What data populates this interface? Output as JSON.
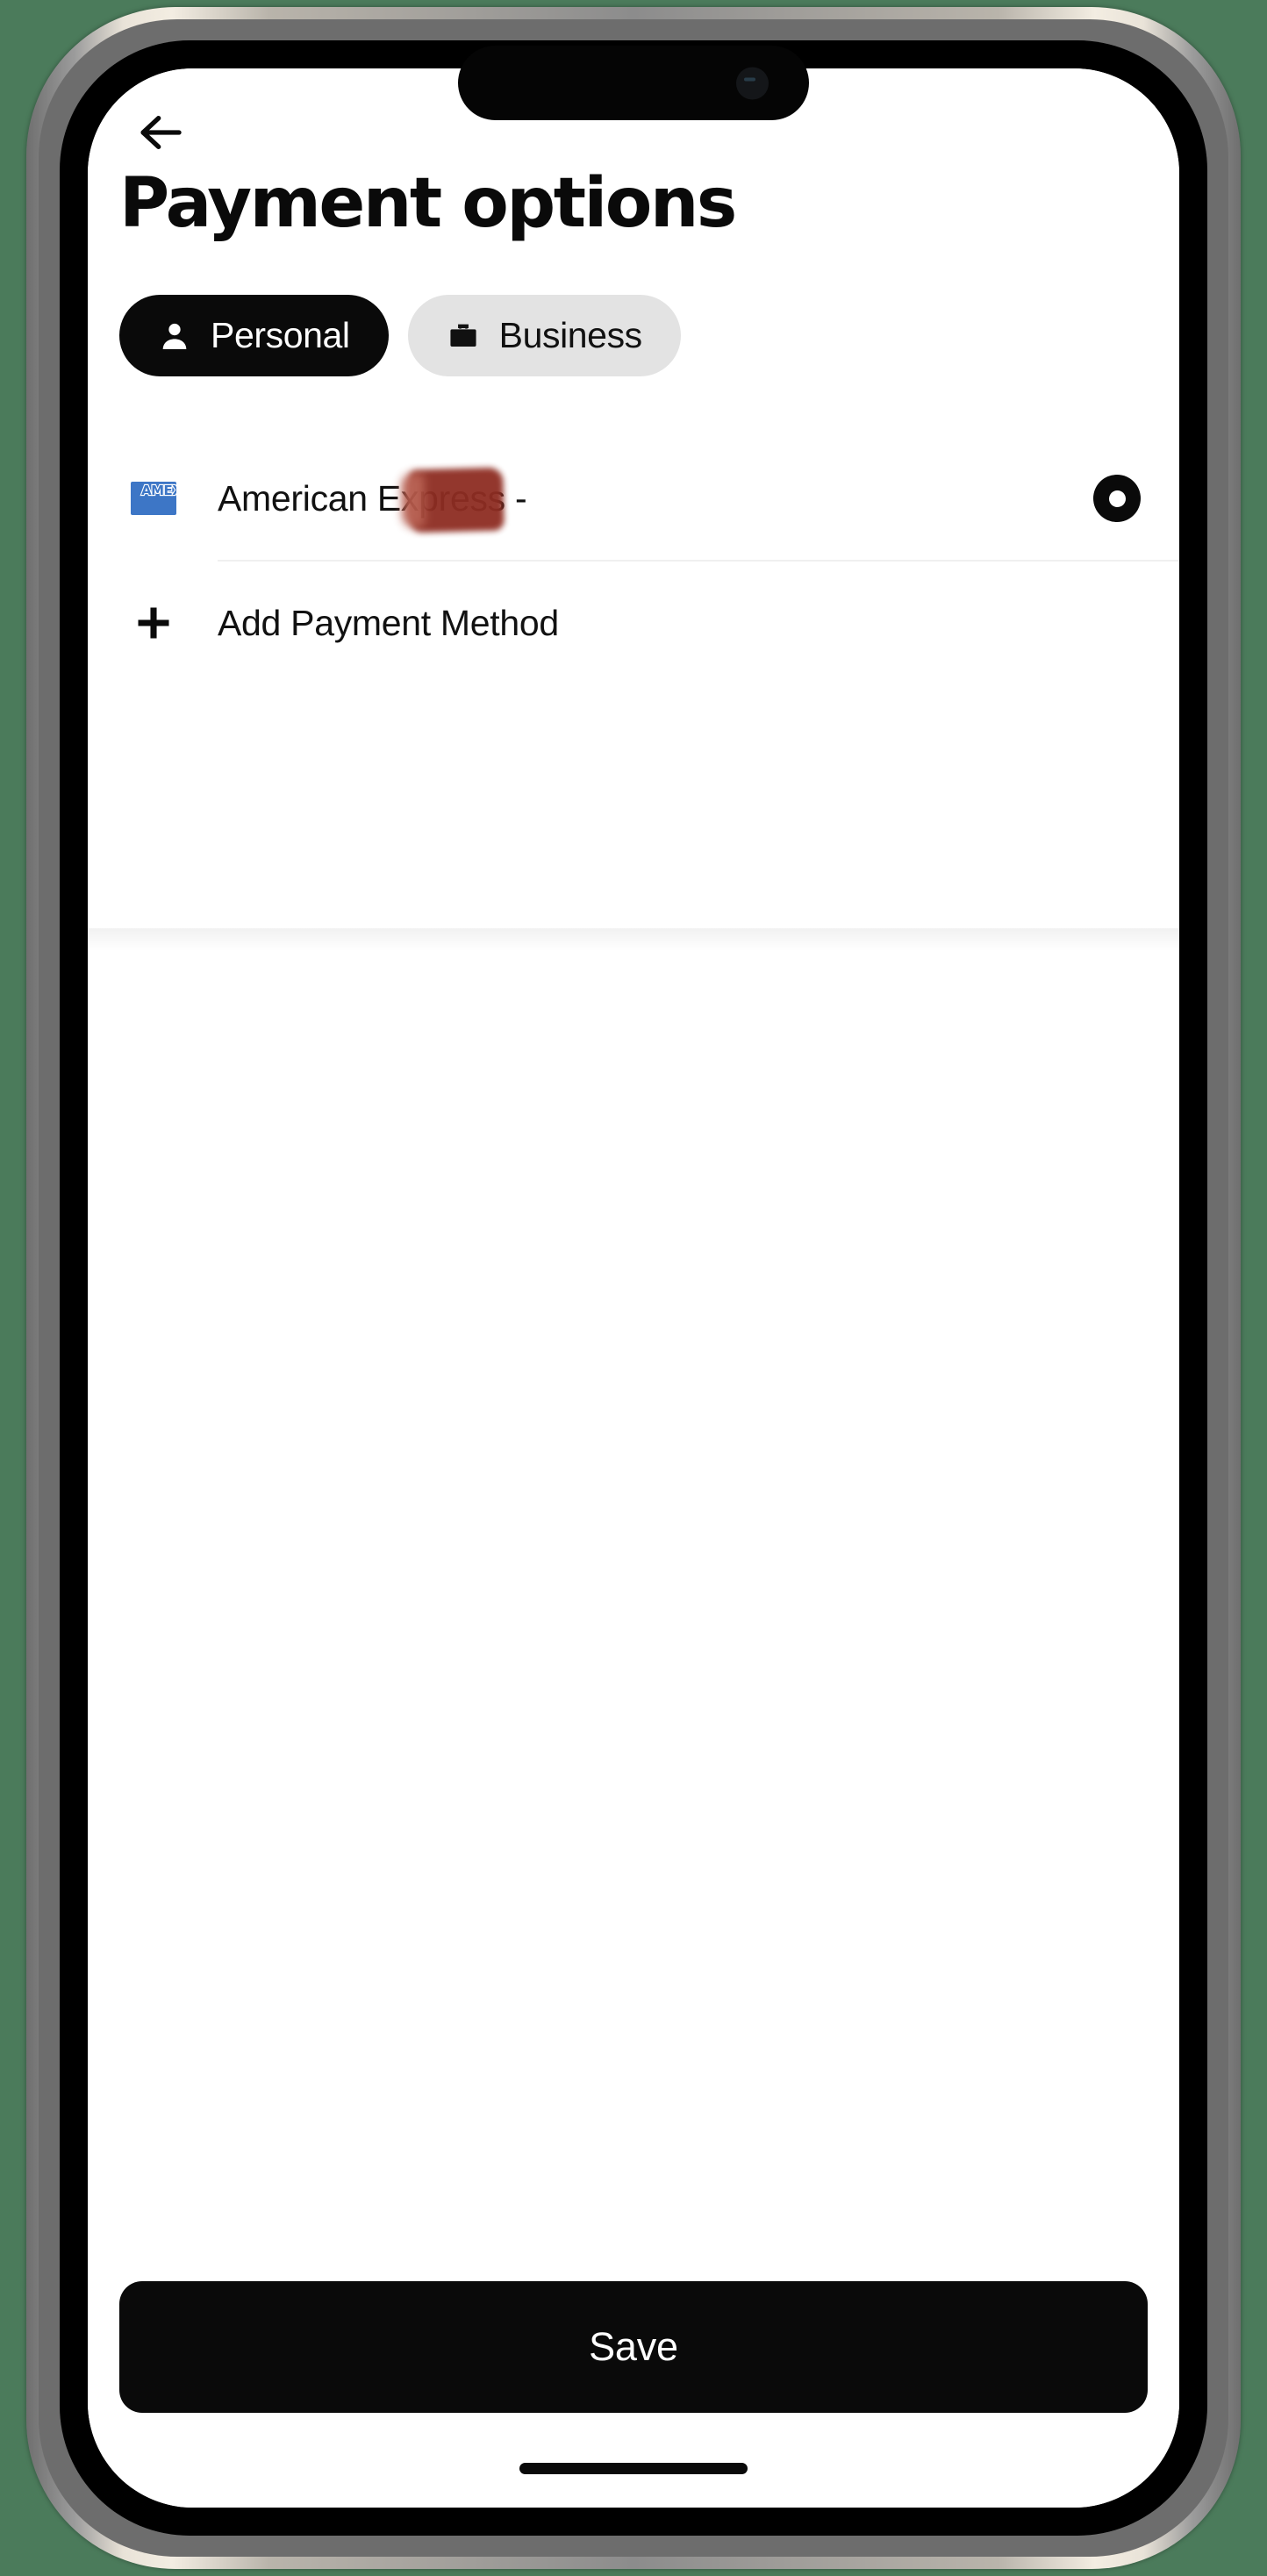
{
  "device": {
    "frame": "iphone-titanium",
    "background_color": "#4b7b5b",
    "island_camera": "camera-dot"
  },
  "header": {
    "back_icon": "arrow-left-icon",
    "title": "Payment options"
  },
  "segmented_control": {
    "selected": "Personal",
    "options": [
      {
        "label": "Personal",
        "icon": "person-icon",
        "selected": true,
        "bg": "#0a0a0a",
        "fg": "#ffffff"
      },
      {
        "label": "Business",
        "icon": "briefcase-icon",
        "selected": false,
        "bg": "#e3e3e3",
        "fg": "#111111"
      }
    ]
  },
  "payment_methods": {
    "rows": [
      {
        "type": "card",
        "brand_icon": "amex-card-icon",
        "brand_logo_text": "AMEX",
        "brand_logo_color": "#3d76c6",
        "label": "American Express -",
        "redacted": true,
        "redaction_color": "#8e2d22",
        "selected": true,
        "radio_icon": "radio-selected-icon"
      }
    ],
    "add_row": {
      "icon": "plus-icon",
      "label": "Add Payment Method"
    }
  },
  "footer": {
    "save_label": "Save",
    "save_color": "#0a0a0a",
    "home_indicator": "home-indicator"
  }
}
